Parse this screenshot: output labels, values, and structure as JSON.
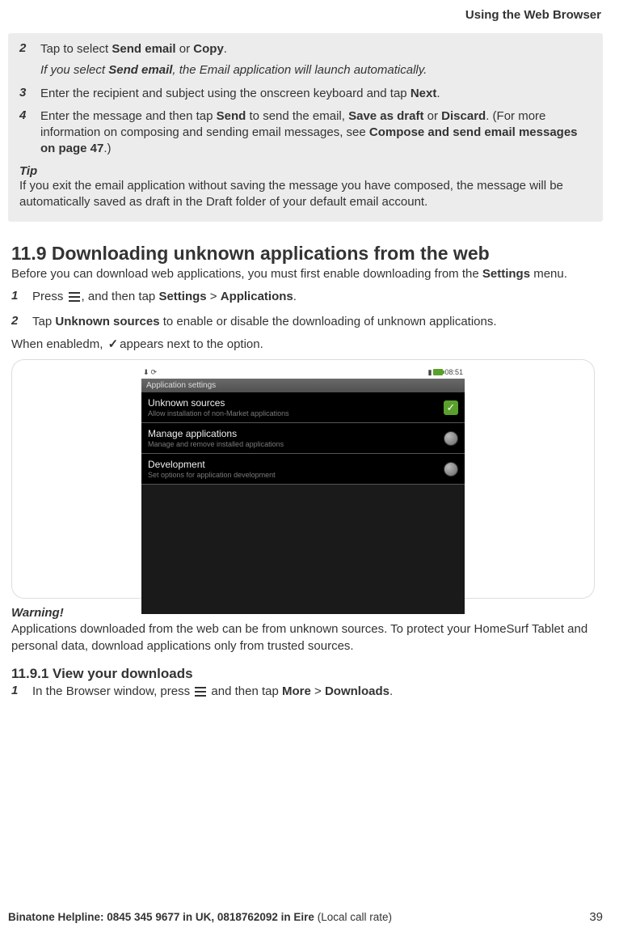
{
  "header": {
    "title": "Using the Web Browser"
  },
  "box": {
    "steps": [
      {
        "num": "2",
        "parts": [
          {
            "t": "Tap to select "
          },
          {
            "t": "Send email",
            "b": true
          },
          {
            "t": " or "
          },
          {
            "t": "Copy",
            "b": true
          },
          {
            "t": "."
          }
        ],
        "note_parts": [
          {
            "t": "If you select ",
            "i": true
          },
          {
            "t": "Send email",
            "b": true,
            "i": true
          },
          {
            "t": ", the Email application will launch automatically.",
            "i": true
          }
        ]
      },
      {
        "num": "3",
        "parts": [
          {
            "t": "Enter the recipient and subject using the onscreen keyboard and tap "
          },
          {
            "t": "Next",
            "b": true
          },
          {
            "t": "."
          }
        ]
      },
      {
        "num": "4",
        "parts": [
          {
            "t": "Enter the message and then tap "
          },
          {
            "t": "Send",
            "b": true
          },
          {
            "t": " to send the email, "
          },
          {
            "t": "Save as draft",
            "b": true
          },
          {
            "t": " or "
          },
          {
            "t": "Discard",
            "b": true
          },
          {
            "t": ". (For more information on composing and sending email messages, see "
          },
          {
            "t": "Compose and send email messages on page 47",
            "b": true
          },
          {
            "t": ".)"
          }
        ]
      }
    ],
    "tip_label": "Tip",
    "tip_body": "If you exit the email application without saving the message you have composed, the message will be automatically saved as draft in the Draft folder of your default email account."
  },
  "section_11_9": {
    "heading": "11.9   Downloading unknown applications from the web",
    "intro_parts": [
      {
        "t": "Before you can download web applications, you must first enable downloading from the "
      },
      {
        "t": "Settings",
        "b": true
      },
      {
        "t": " menu."
      }
    ],
    "steps": [
      {
        "num": "1",
        "parts": [
          {
            "t": "Press "
          },
          {
            "icon": "menu"
          },
          {
            "t": ", and then tap "
          },
          {
            "t": "Settings",
            "b": true
          },
          {
            "t": " > "
          },
          {
            "t": "Applications",
            "b": true
          },
          {
            "t": "."
          }
        ]
      },
      {
        "num": "2",
        "parts": [
          {
            "t": "Tap "
          },
          {
            "t": "Unknown sources",
            "b": true
          },
          {
            "t": " to enable or disable the downloading of unknown applications."
          }
        ]
      }
    ],
    "enabled_parts": [
      {
        "t": "When enabledm, "
      },
      {
        "check": true
      },
      {
        "t": "appears next to the option."
      }
    ]
  },
  "phone": {
    "time": "08:51",
    "title": "Application settings",
    "rows": [
      {
        "name": "unknown-sources",
        "title": "Unknown sources",
        "sub": "Allow installation of non-Market applications",
        "checked": true
      },
      {
        "name": "manage-apps",
        "title": "Manage applications",
        "sub": "Manage and remove installed applications",
        "knob": true
      },
      {
        "name": "development",
        "title": "Development",
        "sub": "Set options for application development",
        "knob": true
      }
    ]
  },
  "warning": {
    "label": "Warning!",
    "body": "Applications downloaded from the web can be from unknown sources. To protect your HomeSurf Tablet and personal data, download applications only from trusted sources."
  },
  "section_11_9_1": {
    "heading": "11.9.1 View your downloads",
    "steps": [
      {
        "num": "1",
        "parts": [
          {
            "t": "In the Browser window, press "
          },
          {
            "icon": "menu"
          },
          {
            "t": " and then tap "
          },
          {
            "t": "More",
            "b": true
          },
          {
            "t": " > "
          },
          {
            "t": "Downloads",
            "b": true
          },
          {
            "t": "."
          }
        ]
      }
    ]
  },
  "footer": {
    "left_bold": "Binatone Helpline: 0845 345 9677 in UK, 0818762092 in Eire ",
    "left_light": "(Local call rate)",
    "page": "39"
  }
}
